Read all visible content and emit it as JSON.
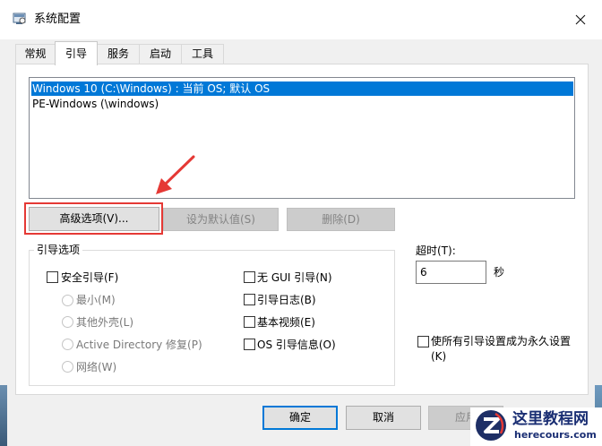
{
  "window": {
    "title": "系统配置"
  },
  "tabs": [
    {
      "label": "常规"
    },
    {
      "label": "引导"
    },
    {
      "label": "服务"
    },
    {
      "label": "启动"
    },
    {
      "label": "工具"
    }
  ],
  "active_tab": "引导",
  "os_list": [
    {
      "label": "Windows 10 (C:\\Windows) : 当前 OS; 默认 OS",
      "selected": true
    },
    {
      "label": "PE-Windows (\\windows)",
      "selected": false
    }
  ],
  "buttons": {
    "advanced": "高级选项(V)...",
    "set_default": "设为默认值(S)",
    "delete": "删除(D)",
    "ok": "确定",
    "cancel": "取消",
    "apply": "应用"
  },
  "boot_options": {
    "legend": "引导选项",
    "safe_boot": "安全引导(F)",
    "minimal": "最小(M)",
    "alternate_shell": "其他外壳(L)",
    "active_directory": "Active Directory 修复(P)",
    "network": "网络(W)",
    "no_gui": "无 GUI 引导(N)",
    "boot_log": "引导日志(B)",
    "base_video": "基本视频(E)",
    "os_boot_info": "OS 引导信息(O)"
  },
  "timeout": {
    "label": "超时(T):",
    "value": "6",
    "unit": "秒"
  },
  "permanent": {
    "label_line1": "使所有引导设置成为永久设置",
    "label_line2": "(K)"
  },
  "watermark": {
    "title": "这里教程网",
    "url": "herecours.com"
  },
  "colors": {
    "selection": "#0078d7",
    "highlight_box": "#e53935",
    "arrow": "#e53935",
    "watermark": "#1a2e73"
  }
}
